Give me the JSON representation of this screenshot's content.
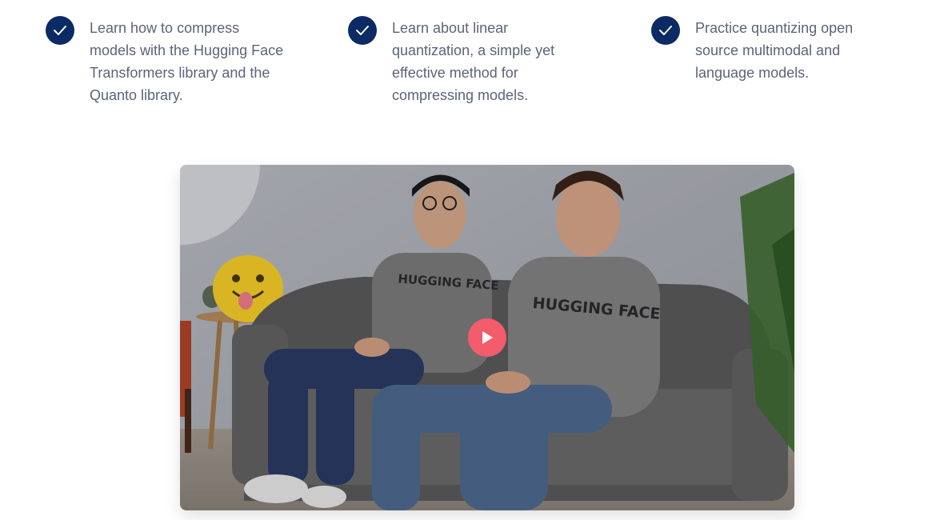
{
  "features": [
    {
      "text": "Learn how to compress models with the Hugging Face Transformers library and the Quanto library.",
      "icon": "check-circle-icon"
    },
    {
      "text": "Learn about linear quantization, a simple yet effective method for compressing models.",
      "icon": "check-circle-icon"
    },
    {
      "text": "Practice quantizing open source multimodal and language models.",
      "icon": "check-circle-icon"
    }
  ],
  "video": {
    "shirt_left": "HUGGING FACE",
    "shirt_right": "HUGGING FACE",
    "play_icon": "play-icon"
  },
  "colors": {
    "check_bg": "#0c2a63",
    "text": "#5b6478",
    "play": "#f25c6b"
  }
}
